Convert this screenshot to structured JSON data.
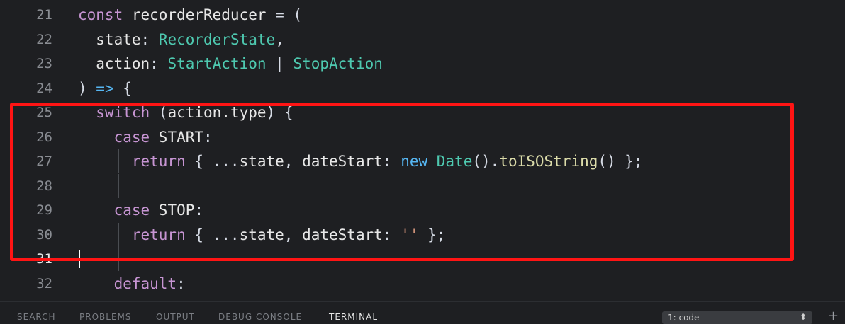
{
  "editor": {
    "lines": [
      {
        "number": "21",
        "tokens": [
          {
            "t": "const ",
            "c": "kw"
          },
          {
            "t": "recorderReducer",
            "c": "name"
          },
          {
            "t": " = (",
            "c": "p"
          }
        ]
      },
      {
        "number": "22",
        "tokens": [
          {
            "t": "  state",
            "c": "name"
          },
          {
            "t": ": ",
            "c": "p"
          },
          {
            "t": "RecorderState",
            "c": "type"
          },
          {
            "t": ",",
            "c": "p"
          }
        ]
      },
      {
        "number": "23",
        "tokens": [
          {
            "t": "  action",
            "c": "name"
          },
          {
            "t": ": ",
            "c": "p"
          },
          {
            "t": "StartAction",
            "c": "type"
          },
          {
            "t": " | ",
            "c": "p"
          },
          {
            "t": "StopAction",
            "c": "type"
          }
        ]
      },
      {
        "number": "24",
        "tokens": [
          {
            "t": ") ",
            "c": "p"
          },
          {
            "t": "=>",
            "c": "op"
          },
          {
            "t": " {",
            "c": "p"
          }
        ]
      },
      {
        "number": "25",
        "tokens": [
          {
            "t": "  switch",
            "c": "kw"
          },
          {
            "t": " (",
            "c": "p"
          },
          {
            "t": "action.type",
            "c": "name"
          },
          {
            "t": ") {",
            "c": "p"
          }
        ]
      },
      {
        "number": "26",
        "tokens": [
          {
            "t": "    case",
            "c": "kw"
          },
          {
            "t": " START",
            "c": "name"
          },
          {
            "t": ":",
            "c": "p"
          }
        ]
      },
      {
        "number": "27",
        "tokens": [
          {
            "t": "      return",
            "c": "kw"
          },
          {
            "t": " { ...",
            "c": "p"
          },
          {
            "t": "state",
            "c": "name"
          },
          {
            "t": ", ",
            "c": "p"
          },
          {
            "t": "dateStart",
            "c": "name"
          },
          {
            "t": ": ",
            "c": "p"
          },
          {
            "t": "new",
            "c": "op"
          },
          {
            "t": " ",
            "c": "p"
          },
          {
            "t": "Date",
            "c": "type"
          },
          {
            "t": "().",
            "c": "p"
          },
          {
            "t": "toISOString",
            "c": "fn"
          },
          {
            "t": "() };",
            "c": "p"
          }
        ]
      },
      {
        "number": "28",
        "tokens": []
      },
      {
        "number": "29",
        "tokens": [
          {
            "t": "    case",
            "c": "kw"
          },
          {
            "t": " STOP",
            "c": "name"
          },
          {
            "t": ":",
            "c": "p"
          }
        ]
      },
      {
        "number": "30",
        "tokens": [
          {
            "t": "      return",
            "c": "kw"
          },
          {
            "t": " { ...",
            "c": "p"
          },
          {
            "t": "state",
            "c": "name"
          },
          {
            "t": ", ",
            "c": "p"
          },
          {
            "t": "dateStart",
            "c": "name"
          },
          {
            "t": ": ",
            "c": "p"
          },
          {
            "t": "''",
            "c": "str"
          },
          {
            "t": " };",
            "c": "p"
          }
        ]
      },
      {
        "number": "31",
        "tokens": []
      },
      {
        "number": "32",
        "tokens": [
          {
            "t": "    default",
            "c": "kw"
          },
          {
            "t": ":",
            "c": "p"
          }
        ]
      }
    ],
    "active_line": "31"
  },
  "panel": {
    "tabs": [
      "SEARCH",
      "PROBLEMS",
      "OUTPUT",
      "DEBUG CONSOLE",
      "TERMINAL"
    ],
    "active_tab": "TERMINAL",
    "terminal_select": "1: code",
    "add_icon": "plus-icon"
  },
  "colors": {
    "background": "#1e1f22",
    "highlight_border": "#ff1414",
    "keyword": "#c795d3",
    "type": "#4ec9b0"
  }
}
